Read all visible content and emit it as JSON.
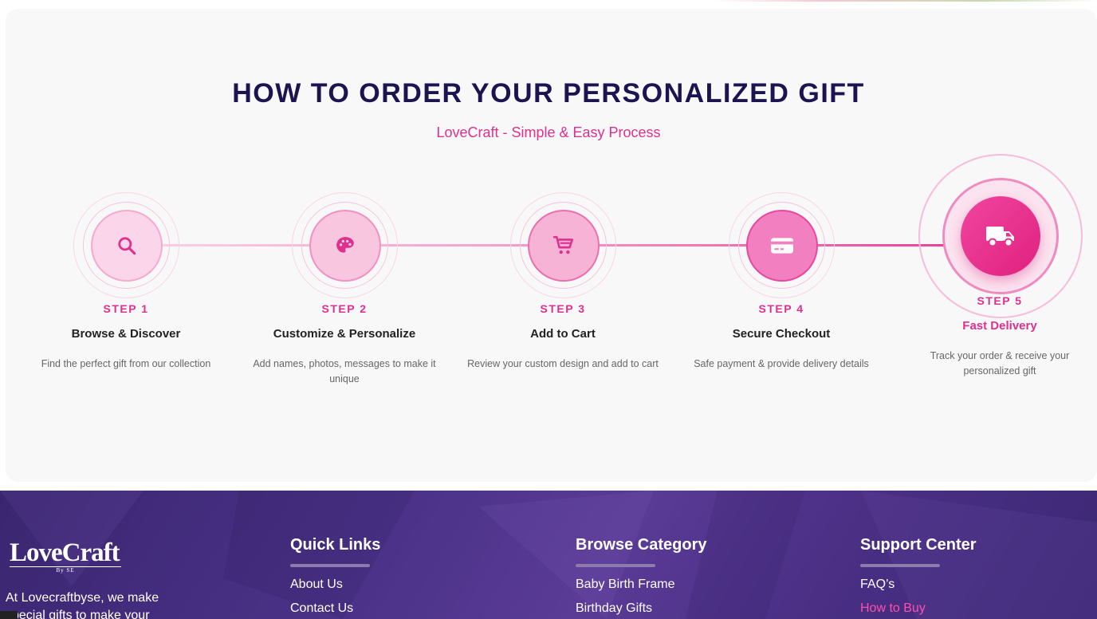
{
  "section": {
    "title": "HOW TO ORDER YOUR PERSONALIZED GIFT",
    "subtitle": "LoveCraft - Simple & Easy Process"
  },
  "steps": [
    {
      "label": "STEP 1",
      "title": "Browse & Discover",
      "desc": "Find the perfect gift from our collection",
      "icon": "search-icon"
    },
    {
      "label": "STEP 2",
      "title": "Customize & Personalize",
      "desc": "Add names, photos, messages to make it unique",
      "icon": "palette-icon"
    },
    {
      "label": "STEP 3",
      "title": "Add to Cart",
      "desc": "Review your custom design and add to cart",
      "icon": "cart-icon"
    },
    {
      "label": "STEP 4",
      "title": "Secure Checkout",
      "desc": "Safe payment & provide delivery details",
      "icon": "credit-card-icon"
    },
    {
      "label": "STEP 5",
      "title": "Fast Delivery",
      "desc": "Track your order & receive your personalized gift",
      "icon": "truck-icon",
      "active": true
    }
  ],
  "colors": {
    "accent": "#e0308f",
    "title": "#1c1450",
    "footer_bg": "#4b3288"
  },
  "footer": {
    "logo_text": "LoveCraft",
    "logo_sub": "By SE",
    "about": "At Lovecraftbyse, we make special gifts to make your moments truly",
    "quick_links": {
      "title": "Quick Links",
      "items": [
        "About Us",
        "Contact Us"
      ]
    },
    "browse_category": {
      "title": "Browse Category",
      "items": [
        "Baby Birth Frame",
        "Birthday Gifts"
      ]
    },
    "support_center": {
      "title": "Support Center",
      "items": [
        "FAQ’s",
        "How to Buy"
      ]
    }
  }
}
